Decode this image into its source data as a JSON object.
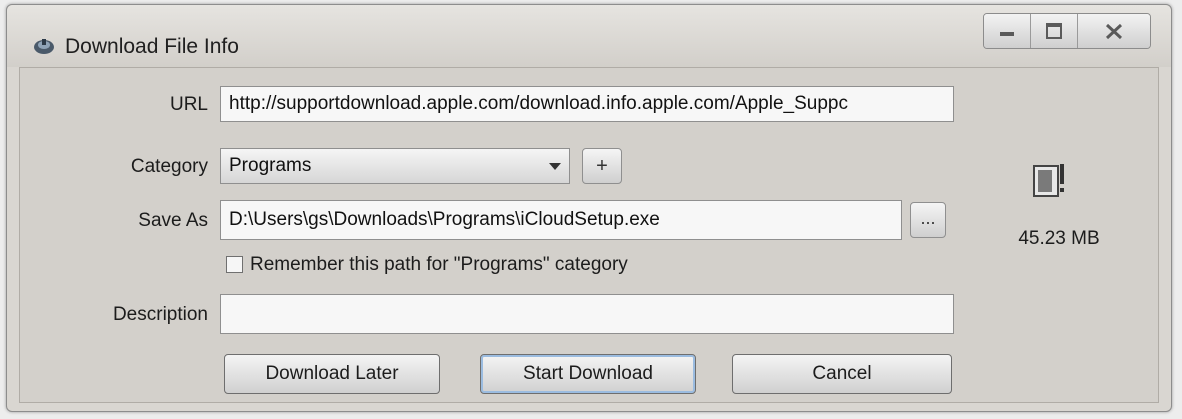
{
  "window": {
    "title": "Download File Info"
  },
  "form": {
    "url_label": "URL",
    "url_value": "http://supportdownload.apple.com/download.info.apple.com/Apple_Suppc",
    "category_label": "Category",
    "category_value": "Programs",
    "add_category_label": "+",
    "save_as_label": "Save As",
    "save_as_value": "D:\\Users\\gs\\Downloads\\Programs\\iCloudSetup.exe",
    "browse_label": "...",
    "remember_label": "Remember this path for \"Programs\" category",
    "description_label": "Description",
    "description_value": ""
  },
  "file_info": {
    "size": "45.23 MB"
  },
  "buttons": {
    "download_later": "Download Later",
    "start_download": "Start Download",
    "cancel": "Cancel"
  },
  "icons": [
    "app-icon",
    "minimize-icon",
    "maximize-icon",
    "close-icon",
    "dropdown-arrow-icon",
    "file-icon"
  ],
  "colors": {
    "dialog_bg": "#d3d0cb",
    "field_bg": "#f7f7f7"
  }
}
